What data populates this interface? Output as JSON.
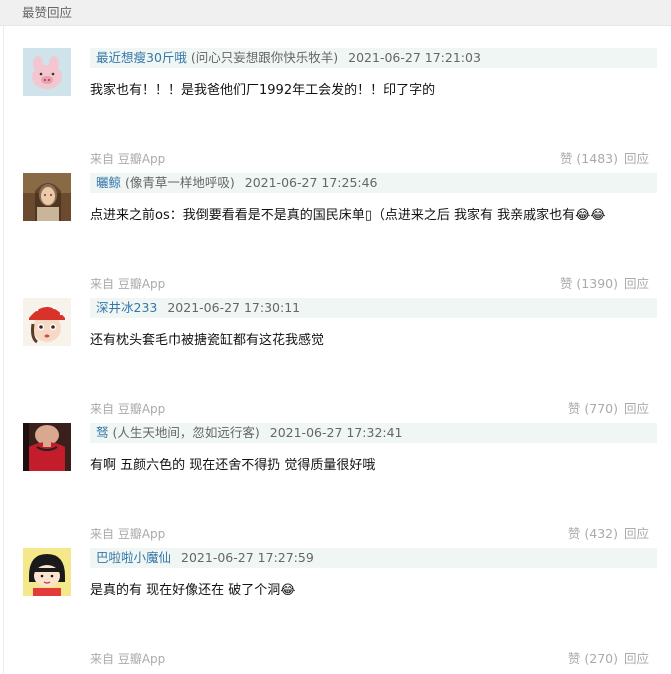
{
  "section": {
    "title": "最赞回应"
  },
  "comments": [
    {
      "username": "最近想瘦30斤哦",
      "status": " (问心只妄想跟你快乐牧羊)",
      "timestamp": "2021-06-27 17:21:03",
      "text": "我家也有！！！是我爸他们厂1992年工会发的！！印了字的",
      "source": "来自 豆瓣App",
      "likes": "赞 (1483)",
      "reply": "回应",
      "avatar_icon": "pink-pig-avatar-icon"
    },
    {
      "username": "曬鲸",
      "status": " (像青草一样地呼吸)",
      "timestamp": "2021-06-27 17:25:46",
      "text": "点进来之前os：我倒要看看是不是真的国民床单▯（点进来之后 我家有 我亲戚家也有😂😂",
      "source": "来自 豆瓣App",
      "likes": "赞 (1390)",
      "reply": "回应",
      "avatar_icon": "girl-photo-avatar-icon"
    },
    {
      "username": "深井冰233",
      "status": "",
      "timestamp": "2021-06-27 17:30:11",
      "text": "还有枕头套毛巾被搪瓷缸都有这花我感觉",
      "source": "来自 豆瓣App",
      "likes": "赞 (770)",
      "reply": "回应",
      "avatar_icon": "red-hat-doll-avatar-icon"
    },
    {
      "username": "驽",
      "status": " (人生天地间，忽如远行客)",
      "timestamp": "2021-06-27 17:32:41",
      "text": "有啊 五颜六色的 现在还舍不得扔 觉得质量很好哦",
      "source": "来自 豆瓣App",
      "likes": "赞 (432)",
      "reply": "回应",
      "avatar_icon": "red-dress-photo-avatar-icon"
    },
    {
      "username": "巴啦啦小魔仙",
      "status": "",
      "timestamp": "2021-06-27 17:27:59",
      "text": "是真的有 现在好像还在 破了个洞😂",
      "source": "来自 豆瓣App",
      "likes": "赞 (270)",
      "reply": "回应",
      "avatar_icon": "cartoon-girl-avatar-icon"
    }
  ],
  "colors": {
    "username": "#3377aa",
    "meta_bar": "#f0f6f3",
    "muted": "#aaaaaa",
    "header_bg": "#f0f0f0"
  }
}
